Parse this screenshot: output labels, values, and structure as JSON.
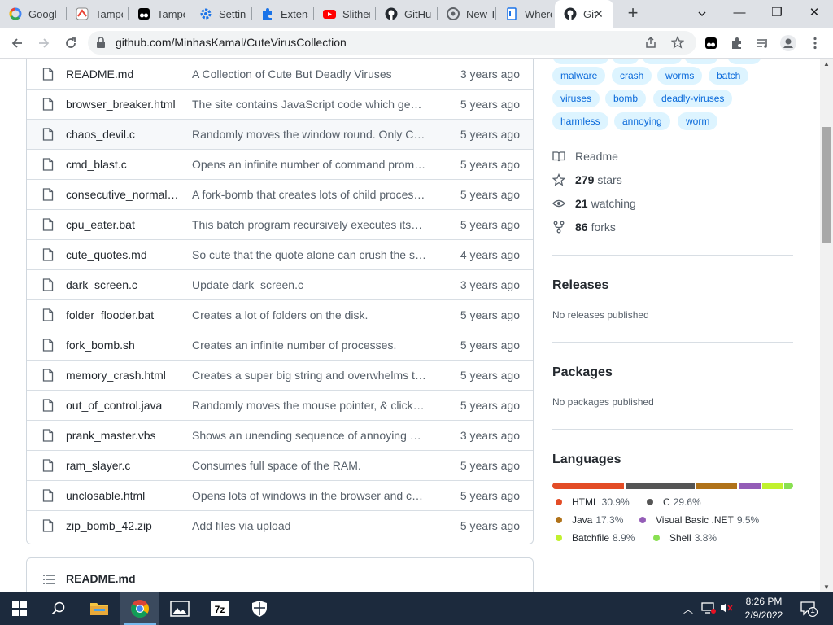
{
  "browser": {
    "tabs": [
      {
        "title": "Google",
        "icon": "google-icon"
      },
      {
        "title": "Tampermonkey",
        "icon": "tampermonkey-icon"
      },
      {
        "title": "Tampermonkey",
        "icon": "tampermonkey-icon"
      },
      {
        "title": "Settings",
        "icon": "gear-icon"
      },
      {
        "title": "Extensions",
        "icon": "puzzle-icon"
      },
      {
        "title": "Slither",
        "icon": "youtube-icon"
      },
      {
        "title": "GitHub",
        "icon": "github-icon"
      },
      {
        "title": "New Tab",
        "icon": "chrome-icon"
      },
      {
        "title": "Where",
        "icon": "docs-icon"
      },
      {
        "title": "GitHub",
        "icon": "github-icon",
        "active": true
      }
    ],
    "url": "github.com/MinhasKamal/CuteVirusCollection"
  },
  "files": [
    {
      "name": "README.md",
      "message": "A Collection of Cute But Deadly Viruses",
      "age": "3 years ago"
    },
    {
      "name": "browser_breaker.html",
      "message": "The site contains JavaScript code which generates...",
      "age": "5 years ago"
    },
    {
      "name": "chaos_devil.c",
      "message": "Randomly moves the window round. Only Ctrl+...",
      "age": "5 years ago"
    },
    {
      "name": "cmd_blast.c",
      "message": "Opens an infinite number of command prompts...",
      "age": "5 years ago"
    },
    {
      "name": "consecutive_normal_...",
      "message": "A fork-bomb that creates lots of child processes...",
      "age": "5 years ago"
    },
    {
      "name": "cpu_eater.bat",
      "message": "This batch program recursively executes itself...",
      "age": "5 years ago"
    },
    {
      "name": "cute_quotes.md",
      "message": "So cute that the quote alone can crush the system...",
      "age": "4 years ago"
    },
    {
      "name": "dark_screen.c",
      "message": "Update dark_screen.c",
      "age": "3 years ago"
    },
    {
      "name": "folder_flooder.bat",
      "message": "Creates a lot of folders on the disk.",
      "age": "5 years ago"
    },
    {
      "name": "fork_bomb.sh",
      "message": "Creates an infinite number of processes.",
      "age": "5 years ago"
    },
    {
      "name": "memory_crash.html",
      "message": "Creates a super big string and overwhelms the...",
      "age": "5 years ago"
    },
    {
      "name": "out_of_control.java",
      "message": "Randomly moves the mouse pointer, & clicks...",
      "age": "5 years ago"
    },
    {
      "name": "prank_master.vbs",
      "message": "Shows an unending sequence of annoying messages...",
      "age": "3 years ago"
    },
    {
      "name": "ram_slayer.c",
      "message": "Consumes full space of the RAM.",
      "age": "5 years ago"
    },
    {
      "name": "unclosable.html",
      "message": "Opens lots of windows in the browser and crashes...",
      "age": "5 years ago"
    },
    {
      "name": "zip_bomb_42.zip",
      "message": "Add files via upload",
      "age": "5 years ago"
    }
  ],
  "readme": {
    "title": "README.md"
  },
  "topics": [
    "malware",
    "crash",
    "worms",
    "batch",
    "viruses",
    "bomb",
    "deadly-viruses",
    "harmless",
    "annoying",
    "worm"
  ],
  "about": {
    "readme_label": "Readme",
    "stars_count": "279",
    "stars_label": "stars",
    "watching_count": "21",
    "watching_label": "watching",
    "forks_count": "86",
    "forks_label": "forks"
  },
  "releases": {
    "heading": "Releases",
    "empty": "No releases published"
  },
  "packages": {
    "heading": "Packages",
    "empty": "No packages published"
  },
  "languages": {
    "heading": "Languages",
    "items": [
      {
        "name": "HTML",
        "percent": "30.9%",
        "value": 30.9,
        "color": "#e34c26"
      },
      {
        "name": "C",
        "percent": "29.6%",
        "value": 29.6,
        "color": "#555555"
      },
      {
        "name": "Java",
        "percent": "17.3%",
        "value": 17.3,
        "color": "#b07219"
      },
      {
        "name": "Visual Basic .NET",
        "percent": "9.5%",
        "value": 9.5,
        "color": "#945db7"
      },
      {
        "name": "Batchfile",
        "percent": "8.9%",
        "value": 8.9,
        "color": "#c1f12e"
      },
      {
        "name": "Shell",
        "percent": "3.8%",
        "value": 3.8,
        "color": "#89e051"
      }
    ]
  },
  "taskbar": {
    "time": "8:26 PM",
    "date": "2/9/2022",
    "notification_count": "1",
    "apps": [
      "file-explorer-icon",
      "chrome-icon",
      "photos-icon",
      "7zip-icon",
      "security-icon"
    ]
  }
}
